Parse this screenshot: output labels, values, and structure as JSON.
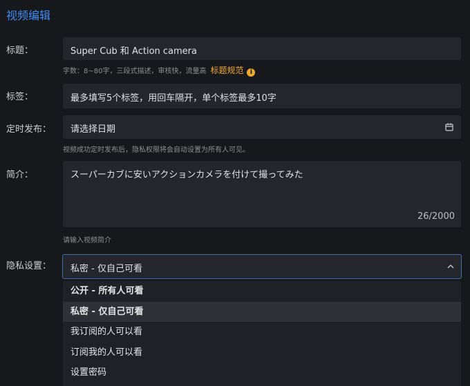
{
  "header": {
    "title": "视频编辑"
  },
  "title_field": {
    "label": "标题：",
    "value": "Super Cub 和 Action camera",
    "hint": "字数：8~80字，三段式描述，审核快，流量高",
    "rule_link": "标题规范",
    "info_icon": "info-icon"
  },
  "tags_field": {
    "label": "标签：",
    "placeholder": "最多填写5个标签，用回车隔开，单个标签最多10字"
  },
  "schedule_field": {
    "label": "定时发布：",
    "placeholder": "请选择日期",
    "icon": "calendar-icon",
    "hint": "视频成功定时发布后，隐私权限将会自动设置为所有人可见。"
  },
  "description_field": {
    "label": "简介：",
    "value": "スーパーカブに安いアクションカメラを付けて撮ってみた",
    "counter": "26/2000",
    "hint": "请输入视频简介"
  },
  "privacy_field": {
    "label": "隐私设置：",
    "selected": "私密 - 仅自己可看",
    "icon": "chevron-up-icon",
    "options": [
      {
        "label": "公开 - 所有人可看"
      },
      {
        "label": "私密 - 仅自己可看"
      },
      {
        "label": "我订阅的人可以看"
      },
      {
        "label": "订阅我的人可以看"
      },
      {
        "label": "设置密码"
      }
    ]
  },
  "colors": {
    "accent": "#3d8bf5",
    "warning": "#f0a830",
    "background": "#17181c",
    "field": "#25262b"
  }
}
